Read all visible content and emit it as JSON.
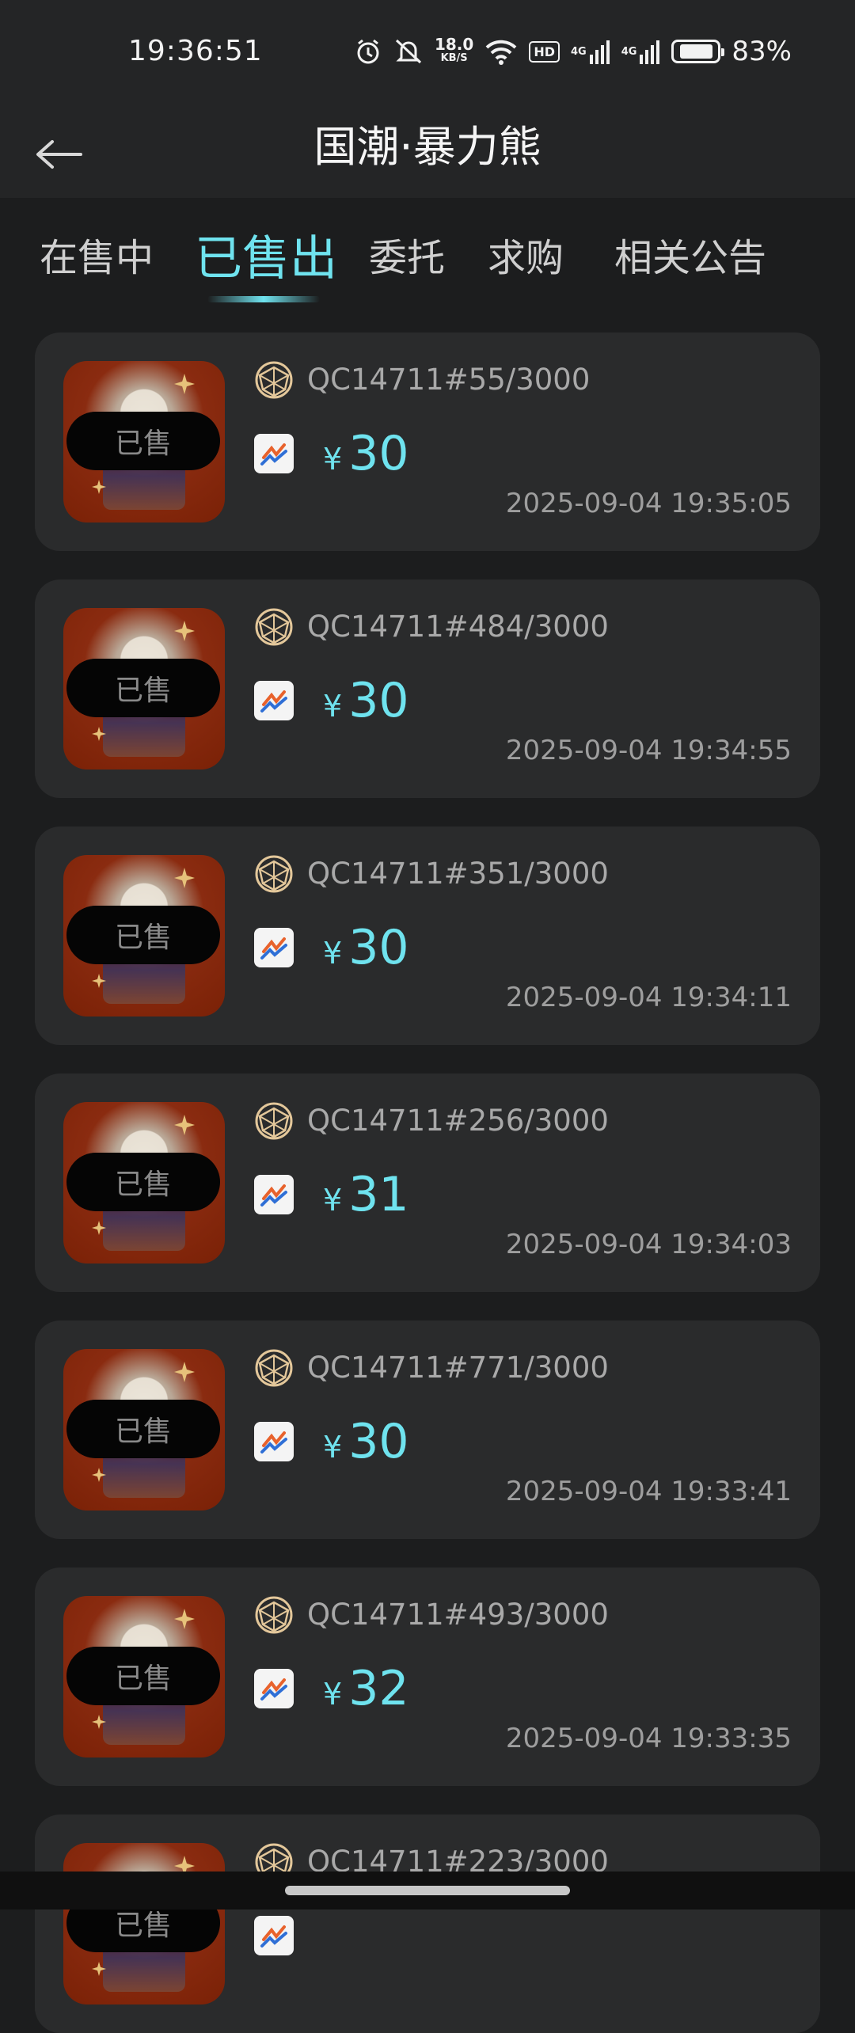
{
  "status_bar": {
    "time": "19:36:51",
    "net_speed_value": "18.0",
    "net_speed_unit": "KB/S",
    "hd_label": "HD",
    "sim1_label": "4G",
    "sim2_label": "4G",
    "battery_percent": "83%",
    "battery_level": 0.83,
    "icons": [
      "alarm-icon",
      "mute-icon",
      "wifi-icon",
      "signal-icon",
      "battery-icon"
    ]
  },
  "header": {
    "title": "国潮·暴力熊",
    "back_icon": "arrow-left-icon"
  },
  "tabs": [
    {
      "label": "在售中",
      "active": false
    },
    {
      "label": "已售出",
      "active": true
    },
    {
      "label": "委托",
      "active": false
    },
    {
      "label": "求购",
      "active": false
    },
    {
      "label": "相关公告",
      "active": false
    }
  ],
  "colors": {
    "accent": "#6fe3ef",
    "background": "#1c1d1e",
    "card": "#2a2b2c"
  },
  "sold_badge": "已售",
  "currency_symbol": "¥",
  "items": [
    {
      "token_id": "QC14711#55/3000",
      "price": "30",
      "time": "2025-09-04 19:35:05"
    },
    {
      "token_id": "QC14711#484/3000",
      "price": "30",
      "time": "2025-09-04 19:34:55"
    },
    {
      "token_id": "QC14711#351/3000",
      "price": "30",
      "time": "2025-09-04 19:34:11"
    },
    {
      "token_id": "QC14711#256/3000",
      "price": "31",
      "time": "2025-09-04 19:34:03"
    },
    {
      "token_id": "QC14711#771/3000",
      "price": "30",
      "time": "2025-09-04 19:33:41"
    },
    {
      "token_id": "QC14711#493/3000",
      "price": "32",
      "time": "2025-09-04 19:33:35"
    },
    {
      "token_id": "QC14711#223/3000",
      "price": "",
      "time": ""
    }
  ]
}
